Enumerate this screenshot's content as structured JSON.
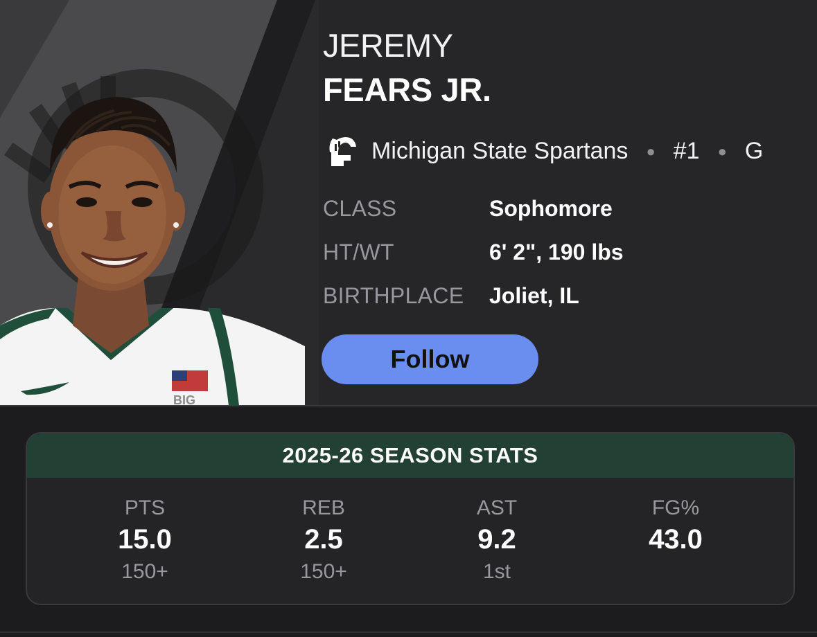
{
  "player": {
    "first_name": "JEREMY",
    "last_name": "FEARS JR."
  },
  "team": {
    "name": "Michigan State Spartans",
    "number": "#1",
    "position": "G",
    "logo_icon": "spartan-helmet-icon"
  },
  "info": [
    {
      "label": "CLASS",
      "value": "Sophomore"
    },
    {
      "label": "HT/WT",
      "value": "6' 2\", 190 lbs"
    },
    {
      "label": "BIRTHPLACE",
      "value": "Joliet, IL"
    }
  ],
  "follow_label": "Follow",
  "stats": {
    "title": "2025-26 SEASON STATS",
    "columns": [
      {
        "label": "PTS",
        "value": "15.0",
        "rank": "150+"
      },
      {
        "label": "REB",
        "value": "2.5",
        "rank": "150+"
      },
      {
        "label": "AST",
        "value": "9.2",
        "rank": "1st"
      },
      {
        "label": "FG%",
        "value": "43.0",
        "rank": ""
      }
    ]
  },
  "colors": {
    "background": "#1c1c1e",
    "hero": "#262628",
    "follow_button": "#6a8ef0",
    "stats_header": "#224034",
    "label_gray": "#98989d"
  }
}
